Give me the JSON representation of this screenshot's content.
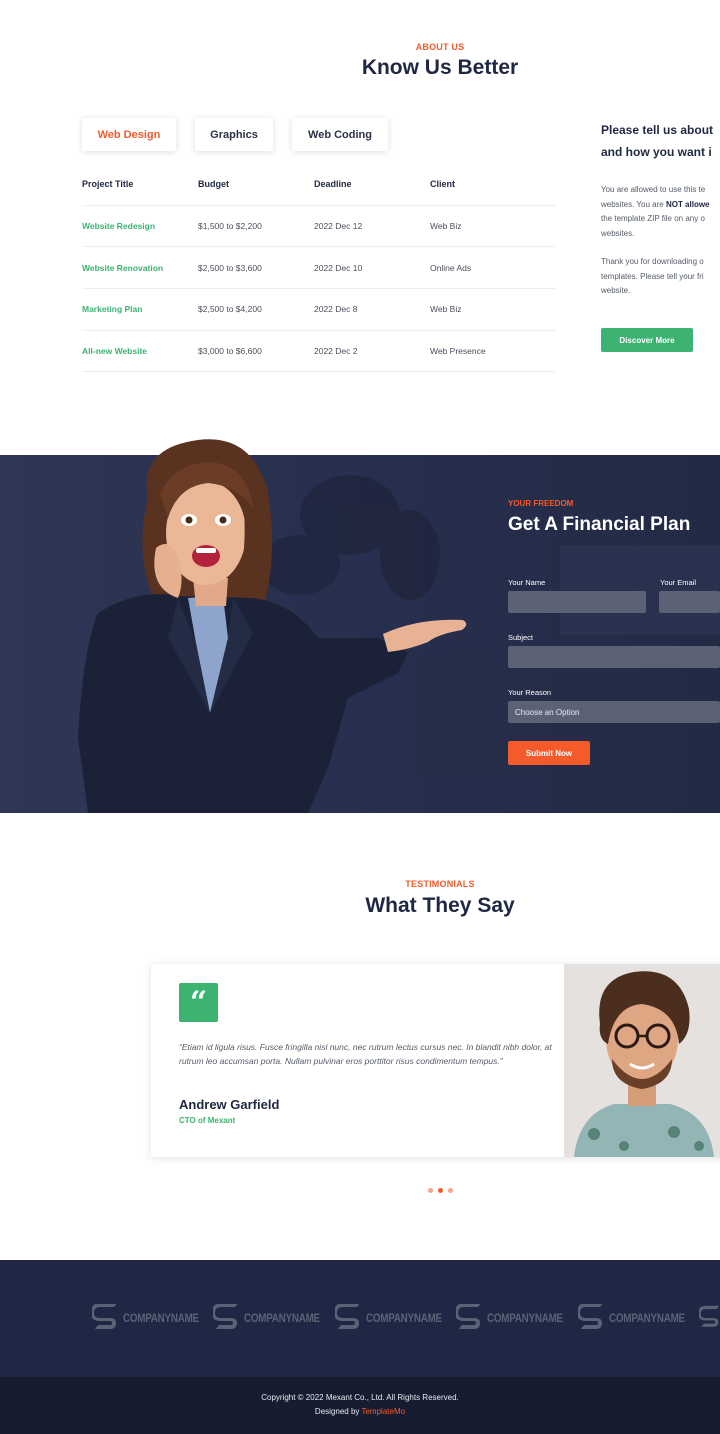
{
  "about": {
    "eyebrow": "ABOUT US",
    "title": "Know Us Better",
    "tabs": [
      "Web Design",
      "Graphics",
      "Web Coding"
    ],
    "table": {
      "headers": [
        "Project Title",
        "Budget",
        "Deadline",
        "Client"
      ],
      "rows": [
        [
          "Website Redesign",
          "$1,500 to $2,200",
          "2022 Dec 12",
          "Web Biz"
        ],
        [
          "Website Renovation",
          "$2,500 to $3,600",
          "2022 Dec 10",
          "Online Ads"
        ],
        [
          "Marketing Plan",
          "$2,500 to $4,200",
          "2022 Dec 8",
          "Web Biz"
        ],
        [
          "All-new Website",
          "$3,000 to $6,600",
          "2022 Dec 2",
          "Web Presence"
        ]
      ]
    },
    "side": {
      "question_line1": "Please tell us about",
      "question_line2": "and how you want i",
      "p1_line1": "You are allowed to use this te",
      "p1_line2_pre": "websites. You are ",
      "p1_line2_bold": "NOT allowe",
      "p1_line3": "the template ZIP file on any o",
      "p1_line4": "websites.",
      "p2_line1": "Thank you for downloading o",
      "p2_line2": "templates. Please tell your fri",
      "p2_line3": "website.",
      "button": "Discover More"
    }
  },
  "financial": {
    "eyebrow": "YOUR FREEDOM",
    "title": "Get A Financial Plan",
    "name_label": "Your Name",
    "email_label": "Your Email",
    "subject_label": "Subject",
    "reason_label": "Your Reason",
    "reason_selected": "Choose an Option",
    "submit": "Submit Now"
  },
  "testimonials": {
    "eyebrow": "TESTIMONIALS",
    "title": "What They Say",
    "quote_mark": "“",
    "quote": "“Etiam id ligula risus. Fusce fringilla nisl nunc, nec rutrum lectus cursus nec. In blandit nibh dolor, at rutrum leo accumsan porta. Nullam pulvinar eros porttitor risus condimentum tempus.”",
    "name": "Andrew Garfield",
    "role": "CTO of Mexant",
    "dots": 3,
    "active_dot": 1
  },
  "partners": {
    "logos": [
      "COMPANYNAME",
      "COMPANYNAME",
      "COMPANYNAME",
      "COMPANYNAME",
      "COMPANYNAME"
    ]
  },
  "footer": {
    "copyright": "Copyright © 2022 Mexant Co., Ltd. All Rights Reserved.",
    "designed_by": "Designed by ",
    "designer": "TemplateMo"
  },
  "colors": {
    "accent": "#f45a2a",
    "green": "#3cb371",
    "navy": "#1f2744"
  }
}
